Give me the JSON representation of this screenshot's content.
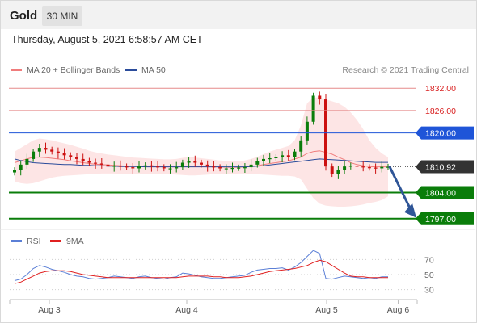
{
  "header": {
    "symbol": "Gold",
    "timeframe": "30 MIN",
    "datetime": "Thursday, August 5, 2021 6:58:57 AM CET"
  },
  "legend": {
    "ma20_label": "MA 20 + Bollinger Bands",
    "ma50_label": "MA 50",
    "credit": "Research © 2021 Trading Central",
    "rsi_label": "RSI",
    "rsi_ma_label": "9MA"
  },
  "colors": {
    "ma20": "#f07c7c",
    "ma50": "#2b4c9b",
    "band_fill": "#fde0e0",
    "resistance": "#e58a8a",
    "pivot": "#1f55d8",
    "support": "#0a7d0a",
    "arrow": "#2f5597",
    "candle_up": "#0a7d0a",
    "candle_down": "#cc1010",
    "rsi": "#5b7fd6",
    "rsi_ma": "#e02020",
    "last_price_bg": "#333333"
  },
  "chart_data": {
    "type": "candlestick",
    "symbol": "Gold",
    "interval": "30 MIN",
    "x_ticks": [
      "Aug 3",
      "Aug 4",
      "Aug 5",
      "Aug 6"
    ],
    "price_range": [
      1795,
      1834
    ],
    "levels": [
      {
        "value": 1832.0,
        "label": "1832.00",
        "kind": "resistance"
      },
      {
        "value": 1826.0,
        "label": "1826.00",
        "kind": "resistance"
      },
      {
        "value": 1820.0,
        "label": "1820.00",
        "kind": "pivot"
      },
      {
        "value": 1804.0,
        "label": "1804.00",
        "kind": "support"
      },
      {
        "value": 1797.0,
        "label": "1797.00",
        "kind": "support"
      }
    ],
    "last_price": {
      "value": 1810.92,
      "label": "1810.92"
    },
    "forecast": {
      "from": 1810.92,
      "to": 1797.0,
      "direction": "down"
    },
    "price_series": [
      1810,
      1811.5,
      1813,
      1815,
      1816,
      1815.5,
      1815,
      1814.5,
      1814,
      1813.5,
      1813,
      1812.5,
      1812,
      1811.8,
      1811.5,
      1811,
      1811.2,
      1811,
      1810.8,
      1810.5,
      1811,
      1811.3,
      1811,
      1810.8,
      1810.5,
      1810.5,
      1810.8,
      1812,
      1812.5,
      1812,
      1811.5,
      1811,
      1810.8,
      1810.5,
      1810.5,
      1810.6,
      1810.7,
      1810.8,
      1811.5,
      1812.5,
      1813,
      1813.2,
      1813.5,
      1814,
      1813.5,
      1815,
      1818,
      1823,
      1830,
      1829,
      1811,
      1809,
      1810,
      1811,
      1811.2,
      1811,
      1810.8,
      1810.7,
      1810.5,
      1810.9,
      1810.92
    ],
    "ma20_series": [
      1812,
      1812.5,
      1813,
      1813.5,
      1813.5,
      1813.4,
      1813.2,
      1813,
      1812.8,
      1812.5,
      1812.3,
      1812,
      1811.8,
      1811.6,
      1811.5,
      1811.4,
      1811.3,
      1811.2,
      1811.1,
      1811,
      1811,
      1811,
      1811,
      1811,
      1810.9,
      1810.9,
      1810.9,
      1811,
      1811,
      1811,
      1811,
      1810.9,
      1810.9,
      1810.9,
      1810.8,
      1810.8,
      1810.8,
      1810.9,
      1811,
      1811.2,
      1811.5,
      1811.8,
      1812,
      1812.3,
      1812.5,
      1813,
      1813.5,
      1814.5,
      1815,
      1815.2,
      1814.8,
      1814.3,
      1813.5,
      1812.8,
      1812,
      1811.5,
      1811.2,
      1811,
      1810.9,
      1810.9,
      1810.9
    ],
    "ma50_series": [
      1813,
      1812.6,
      1812.3,
      1812,
      1811.9,
      1811.8,
      1811.7,
      1811.6,
      1811.5,
      1811.5,
      1811.4,
      1811.3,
      1811.3,
      1811.2,
      1811.2,
      1811.1,
      1811.1,
      1811,
      1811,
      1811,
      1811,
      1810.9,
      1810.9,
      1810.9,
      1810.9,
      1810.9,
      1810.9,
      1810.9,
      1810.9,
      1810.9,
      1810.9,
      1810.9,
      1810.9,
      1810.9,
      1810.9,
      1810.9,
      1810.9,
      1810.9,
      1811,
      1811.1,
      1811.2,
      1811.4,
      1811.6,
      1811.8,
      1812,
      1812.2,
      1812.4,
      1812.6,
      1812.8,
      1813,
      1812.9,
      1812.8,
      1812.7,
      1812.6,
      1812.5,
      1812.4,
      1812.3,
      1812.2,
      1812.1,
      1812.1,
      1812.1
    ],
    "bollinger_upper": [
      1815,
      1816,
      1817,
      1818,
      1818.5,
      1818.3,
      1818,
      1817.6,
      1817.2,
      1816.8,
      1816.3,
      1815.8,
      1815.2,
      1814.8,
      1814.5,
      1814.2,
      1814,
      1813.8,
      1813.6,
      1813.4,
      1813.3,
      1813.2,
      1813.1,
      1813,
      1812.9,
      1812.9,
      1813,
      1813.3,
      1813.5,
      1813.4,
      1813.2,
      1813,
      1812.8,
      1812.6,
      1812.5,
      1812.4,
      1812.4,
      1812.6,
      1813,
      1813.6,
      1814.3,
      1815,
      1815.5,
      1816,
      1816.5,
      1818,
      1822,
      1828,
      1829.5,
      1829.5,
      1829,
      1828.5,
      1828,
      1827,
      1825.5,
      1823.5,
      1821,
      1818,
      1816,
      1814.5,
      1813.5
    ],
    "bollinger_lower": [
      1807,
      1806.5,
      1806.3,
      1806.5,
      1807,
      1807.5,
      1808,
      1808.3,
      1808.5,
      1808.6,
      1808.7,
      1808.8,
      1808.9,
      1809,
      1809.1,
      1809.1,
      1809.1,
      1809,
      1809,
      1809,
      1809,
      1809,
      1809,
      1809,
      1809,
      1808.9,
      1808.8,
      1808.7,
      1808.6,
      1808.6,
      1808.7,
      1808.8,
      1808.9,
      1809,
      1809,
      1809,
      1809.1,
      1809.1,
      1809,
      1808.9,
      1808.8,
      1808.7,
      1808.6,
      1808.5,
      1808.5,
      1808.3,
      1807.5,
      1805,
      1802.5,
      1801,
      1800.5,
      1800.3,
      1800.2,
      1800.2,
      1800.3,
      1800.5,
      1800.8,
      1801.2,
      1801.5,
      1802,
      1803
    ],
    "rsi": {
      "ticks": [
        30,
        50,
        70
      ],
      "range": [
        20,
        80
      ],
      "values": [
        42,
        44,
        50,
        58,
        62,
        60,
        57,
        55,
        53,
        50,
        48,
        47,
        45,
        44,
        45,
        46,
        48,
        47,
        46,
        45,
        47,
        48,
        46,
        45,
        44,
        46,
        47,
        52,
        51,
        49,
        47,
        46,
        45,
        45,
        46,
        47,
        48,
        49,
        53,
        56,
        57,
        58,
        58,
        59,
        56,
        60,
        66,
        74,
        82,
        78,
        45,
        44,
        46,
        48,
        47,
        46,
        45,
        46,
        45,
        47,
        47
      ],
      "ma9": [
        38,
        40,
        44,
        48,
        52,
        54,
        55,
        55,
        55,
        54,
        52,
        50,
        49,
        48,
        47,
        46,
        46,
        46,
        46,
        46,
        46,
        46,
        46,
        46,
        46,
        46,
        46,
        47,
        48,
        48,
        48,
        48,
        47,
        47,
        46,
        46,
        46,
        47,
        48,
        50,
        52,
        54,
        55,
        56,
        57,
        58,
        60,
        62,
        66,
        69,
        67,
        62,
        57,
        52,
        48,
        47,
        47,
        46,
        46,
        46,
        46
      ]
    }
  }
}
